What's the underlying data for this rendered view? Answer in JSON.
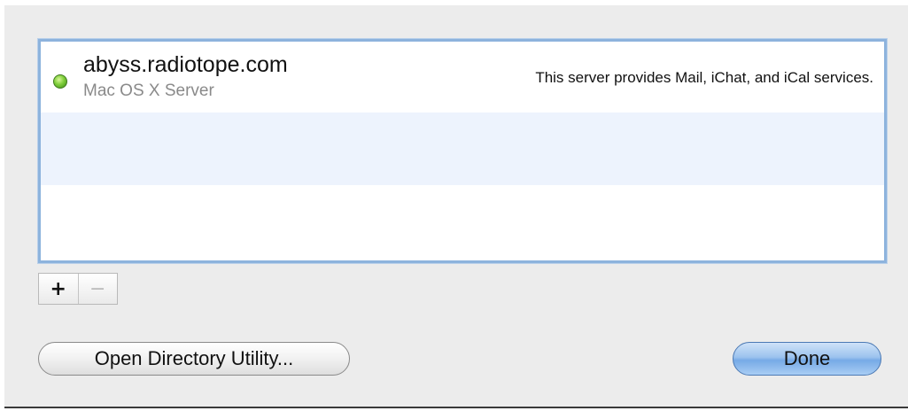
{
  "server_list": {
    "rows": [
      {
        "name": "abyss.radiotope.com",
        "type": "Mac OS X Server",
        "description": "This server provides Mail, iChat, and iCal services.",
        "status_color": "#7fce3a"
      }
    ]
  },
  "list_controls": {
    "add_label": "+",
    "remove_label": "−"
  },
  "buttons": {
    "open_directory_utility": "Open Directory Utility...",
    "done": "Done"
  }
}
